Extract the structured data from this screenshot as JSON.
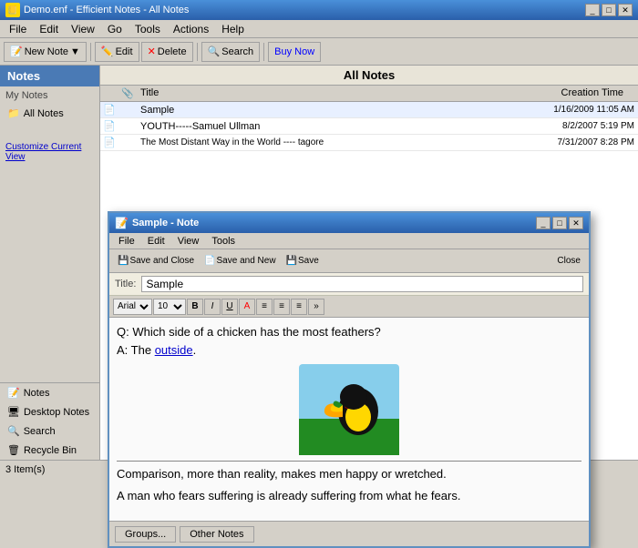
{
  "app": {
    "title": "Demo.enf - Efficient Notes - All Notes",
    "icon": "📒"
  },
  "titlebar": {
    "controls": [
      "_",
      "□",
      "✕"
    ]
  },
  "menu": {
    "items": [
      "File",
      "Edit",
      "View",
      "Go",
      "Tools",
      "Actions",
      "Help"
    ]
  },
  "toolbar": {
    "new_note": "New Note",
    "edit": "Edit",
    "delete": "Delete",
    "search": "Search",
    "buy_now": "Buy Now"
  },
  "sidebar": {
    "header": "Notes",
    "my_notes": "My Notes",
    "all_notes": "All Notes",
    "customize_link": "Customize Current View",
    "bottom_items": [
      {
        "icon": "📝",
        "label": "Notes"
      },
      {
        "icon": "🖥",
        "label": "Desktop Notes"
      },
      {
        "icon": "🔍",
        "label": "Search"
      },
      {
        "icon": "🗑",
        "label": "Recycle Bin"
      }
    ]
  },
  "notes_list": {
    "header": "All Notes",
    "columns": {
      "icon": "",
      "attach": "📎",
      "title": "Title",
      "creation": "Creation Time"
    },
    "rows": [
      {
        "title": "Sample",
        "creation": "1/16/2009 11:05 AM"
      },
      {
        "title": "YOUTH-----Samuel Ullman",
        "creation": "8/2/2007 5:19 PM"
      },
      {
        "title": "The Most Distant Way in the World ---- tagore",
        "creation": "7/31/2007 8:28 PM"
      }
    ]
  },
  "status_bar": {
    "text": "3 Item(s)"
  },
  "note_window": {
    "title": "Sample - Note",
    "menu": [
      "File",
      "Edit",
      "View",
      "Tools"
    ],
    "toolbar": {
      "save_close": "Save and Close",
      "save_new": "Save and New",
      "save": "Save",
      "close": "Close"
    },
    "title_label": "Title:",
    "title_value": "Sample",
    "content": {
      "qa_line": "Q: Which side of a chicken has the most feathers?",
      "answer_prefix": "A: The ",
      "answer_link": "outside",
      "quote1": "Comparison, more than reality, makes men happy or wretched.",
      "quote2": "A man who fears suffering is already suffering from what he fears."
    },
    "footer": {
      "groups_btn": "Groups...",
      "other_notes_btn": "Other Notes"
    }
  }
}
